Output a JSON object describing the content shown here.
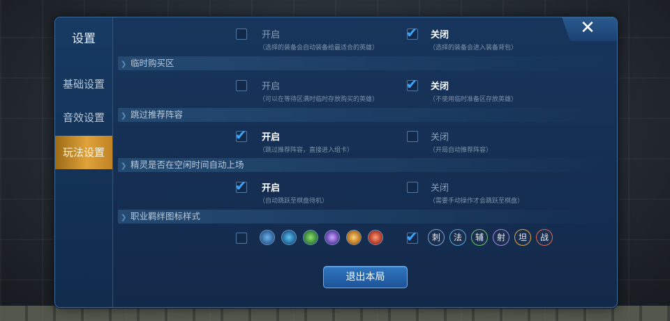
{
  "sidebar": {
    "title": "设置",
    "items": [
      {
        "label": "基础设置",
        "active": false
      },
      {
        "label": "音效设置",
        "active": false
      },
      {
        "label": "玩法设置",
        "active": true
      }
    ]
  },
  "sections": [
    {
      "header": "",
      "options": [
        {
          "label": "开启",
          "desc": "（选择的装备会自动装备给最适合的英雄）",
          "checked": false
        },
        {
          "label": "关闭",
          "desc": "（选择的装备会进入装备背包）",
          "checked": true
        }
      ]
    },
    {
      "header": "临时购买区",
      "options": [
        {
          "label": "开启",
          "desc": "（可以在等待区满时临时存放购买的英雄）",
          "checked": false
        },
        {
          "label": "关闭",
          "desc": "（不使用临时准备区存放英雄）",
          "checked": true
        }
      ]
    },
    {
      "header": "跳过推荐阵容",
      "options": [
        {
          "label": "开启",
          "desc": "（跳过推荐阵容，直接进入组卡）",
          "checked": true
        },
        {
          "label": "关闭",
          "desc": "（开局自动推荐阵容）",
          "checked": false
        }
      ]
    },
    {
      "header": "精灵是否在空闲时间自动上场",
      "options": [
        {
          "label": "开启",
          "desc": "（自动跳跃至棋盘待机）",
          "checked": true
        },
        {
          "label": "关闭",
          "desc": "（需要手动操作才会跳跃至棋盘）",
          "checked": false
        }
      ]
    },
    {
      "header": "职业羁绊图标样式",
      "options": [
        {
          "label": "",
          "desc": "",
          "checked": false
        },
        {
          "label": "",
          "desc": "",
          "checked": true
        }
      ]
    }
  ],
  "icon_style": {
    "graphic_icons": [
      "assassin-icon",
      "mage-icon",
      "support-icon",
      "marksman-icon",
      "tank-icon",
      "warrior-icon"
    ],
    "text_badges": [
      "刺",
      "法",
      "辅",
      "射",
      "坦",
      "战"
    ]
  },
  "exit_button": "退出本局",
  "colors": {
    "panel_bg": "#17355c",
    "active_tab": "#e0a23a",
    "check_blue": "#3aa6ff",
    "button_blue": "#2f76c0"
  }
}
